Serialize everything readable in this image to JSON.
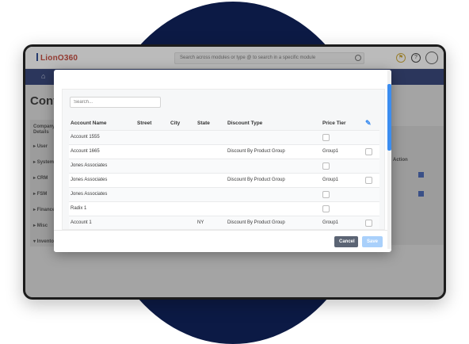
{
  "app": {
    "logo": "LionO360",
    "search_placeholder": "Search across modules or type @ to search in a specific module"
  },
  "page": {
    "title": "Configuration"
  },
  "left_nav": {
    "header": "Company Details",
    "items": [
      "User",
      "System",
      "CRM",
      "FSM",
      "Finance",
      "Misc",
      "Inventory"
    ]
  },
  "right_card": {
    "header": "Action"
  },
  "modal": {
    "search_placeholder": "Search...",
    "columns": [
      "Account Name",
      "Street",
      "City",
      "State",
      "Discount Type",
      "Price Tier"
    ],
    "rows": [
      {
        "account": "Account 1555",
        "street": "",
        "city": "",
        "state": "",
        "discount": "",
        "tier": "",
        "selected": false
      },
      {
        "account": "Account 1665",
        "street": "",
        "city": "",
        "state": "",
        "discount": "Discount By Product Group",
        "tier": "Group1",
        "selected": false
      },
      {
        "account": "Jones Associates",
        "street": "",
        "city": "",
        "state": "",
        "discount": "",
        "tier": "",
        "selected": false
      },
      {
        "account": "Jones Associates",
        "street": "",
        "city": "",
        "state": "",
        "discount": "Discount By Product Group",
        "tier": "Group1",
        "selected": false
      },
      {
        "account": "Jones Associates",
        "street": "",
        "city": "",
        "state": "",
        "discount": "",
        "tier": "",
        "selected": false
      },
      {
        "account": "Radix 1",
        "street": "",
        "city": "",
        "state": "",
        "discount": "",
        "tier": "",
        "selected": false
      },
      {
        "account": "Account 1",
        "street": "",
        "city": "",
        "state": "NY",
        "discount": "Discount By Product Group",
        "tier": "Group1",
        "selected": false
      }
    ],
    "cancel_label": "Cancel",
    "save_label": "Save"
  },
  "colors": {
    "background_circle": "#0c1a45",
    "nav": "#23336e",
    "accent": "#3b8df0",
    "cancel": "#5b6474",
    "save_disabled": "#a9d0fb"
  }
}
